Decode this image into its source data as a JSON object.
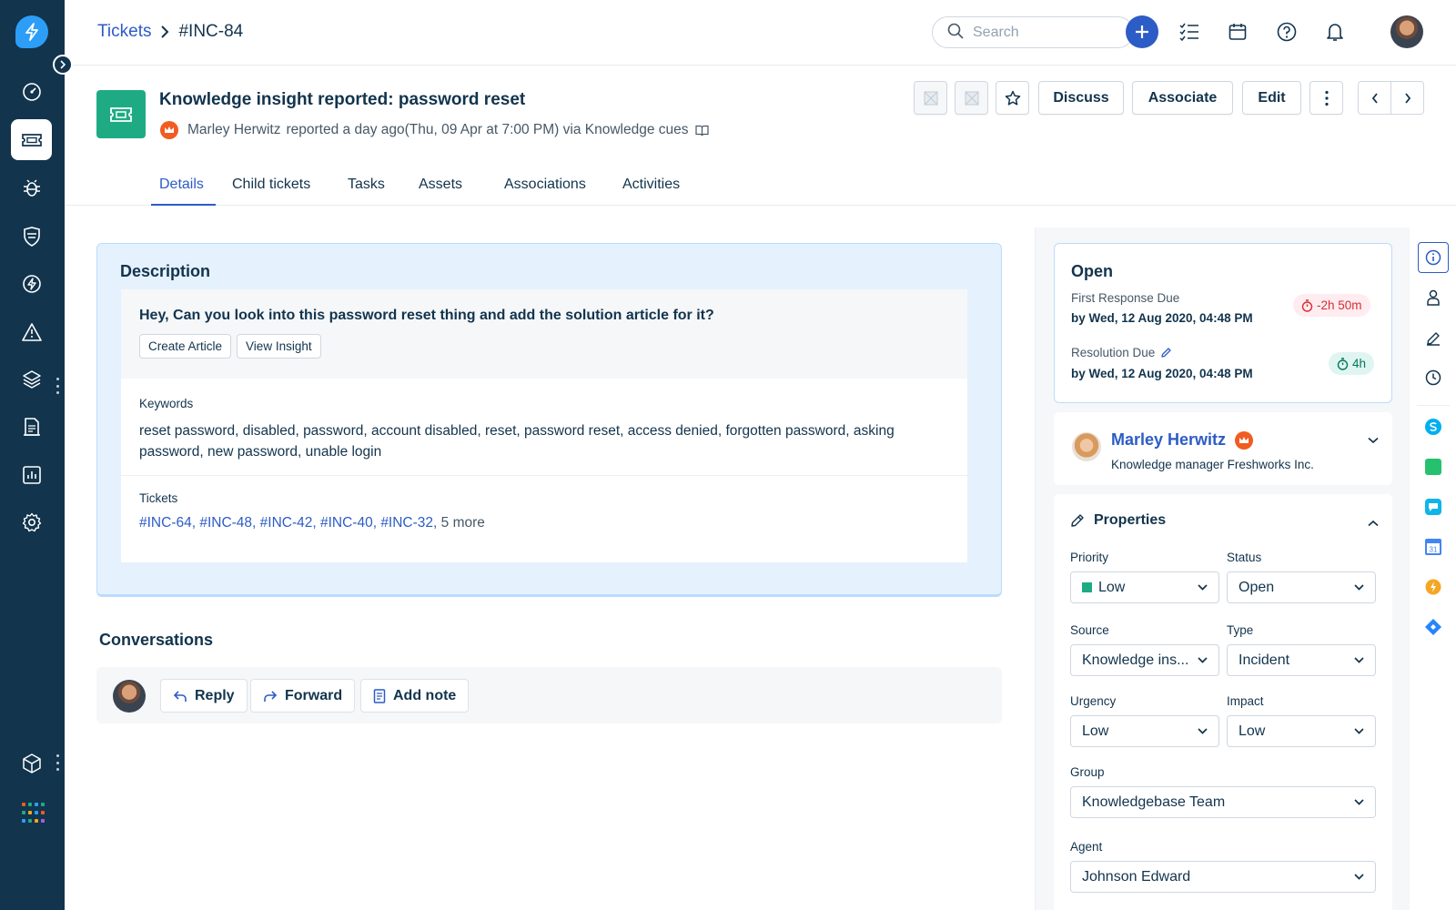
{
  "breadcrumb": {
    "parent": "Tickets",
    "current": "#INC-84"
  },
  "header": {
    "search_placeholder": "Search"
  },
  "ticket": {
    "title": "Knowledge insight reported: password reset",
    "reporter": "Marley Herwitz",
    "meta": "reported a day ago(Thu, 09 Apr at 7:00 PM) via Knowledge cues"
  },
  "toolbar": {
    "discuss": "Discuss",
    "associate": "Associate",
    "edit": "Edit"
  },
  "tabs": [
    "Details",
    "Child tickets",
    "Tasks",
    "Assets",
    "Associations",
    "Activities"
  ],
  "description": {
    "title": "Description",
    "question": "Hey, Can you look into this password reset thing and add the solution article for it?",
    "create_article": "Create Article",
    "view_insight": "View Insight",
    "keywords_label": "Keywords",
    "keywords": "reset password, disabled, password, account disabled, reset, password reset, access denied, forgotten password, asking password, new password, unable login",
    "tickets_label": "Tickets",
    "ticket_links": "#INC-64, #INC-48, #INC-42, #INC-40, #INC-32,",
    "more": "5 more"
  },
  "conversations": {
    "title": "Conversations",
    "reply": "Reply",
    "forward": "Forward",
    "add_note": "Add note"
  },
  "status": {
    "title": "Open",
    "first_response_label": "First Response Due",
    "first_response_value": "by Wed, 12 Aug 2020, 04:48 PM",
    "first_response_sla": "-2h 50m",
    "resolution_label": "Resolution Due",
    "resolution_value": "by Wed, 12 Aug 2020, 04:48 PM",
    "resolution_sla": "4h"
  },
  "contact": {
    "name": "Marley Herwitz",
    "subtitle": "Knowledge manager Freshworks Inc."
  },
  "properties": {
    "title": "Properties",
    "priority_label": "Priority",
    "priority": "Low",
    "status_label": "Status",
    "status": "Open",
    "source_label": "Source",
    "source": "Knowledge ins...",
    "type_label": "Type",
    "type": "Incident",
    "urgency_label": "Urgency",
    "urgency": "Low",
    "impact_label": "Impact",
    "impact": "Low",
    "group_label": "Group",
    "group": "Knowledgebase Team",
    "agent_label": "Agent",
    "agent": "Johnson Edward"
  },
  "colors": {
    "brand": "#2c5cc5",
    "nav_bg": "#12344d",
    "ticket_icon": "#1eab84",
    "sla_overdue": "#d72d30",
    "sla_ok": "#00795b"
  },
  "icons": [
    "lightning-logo-icon",
    "dashboard-icon",
    "ticket-icon",
    "bug-icon",
    "shield-icon",
    "bolt-icon",
    "warning-icon",
    "layers-icon",
    "document-icon",
    "report-icon",
    "gear-icon",
    "cube-icon",
    "apps-grid-icon"
  ]
}
